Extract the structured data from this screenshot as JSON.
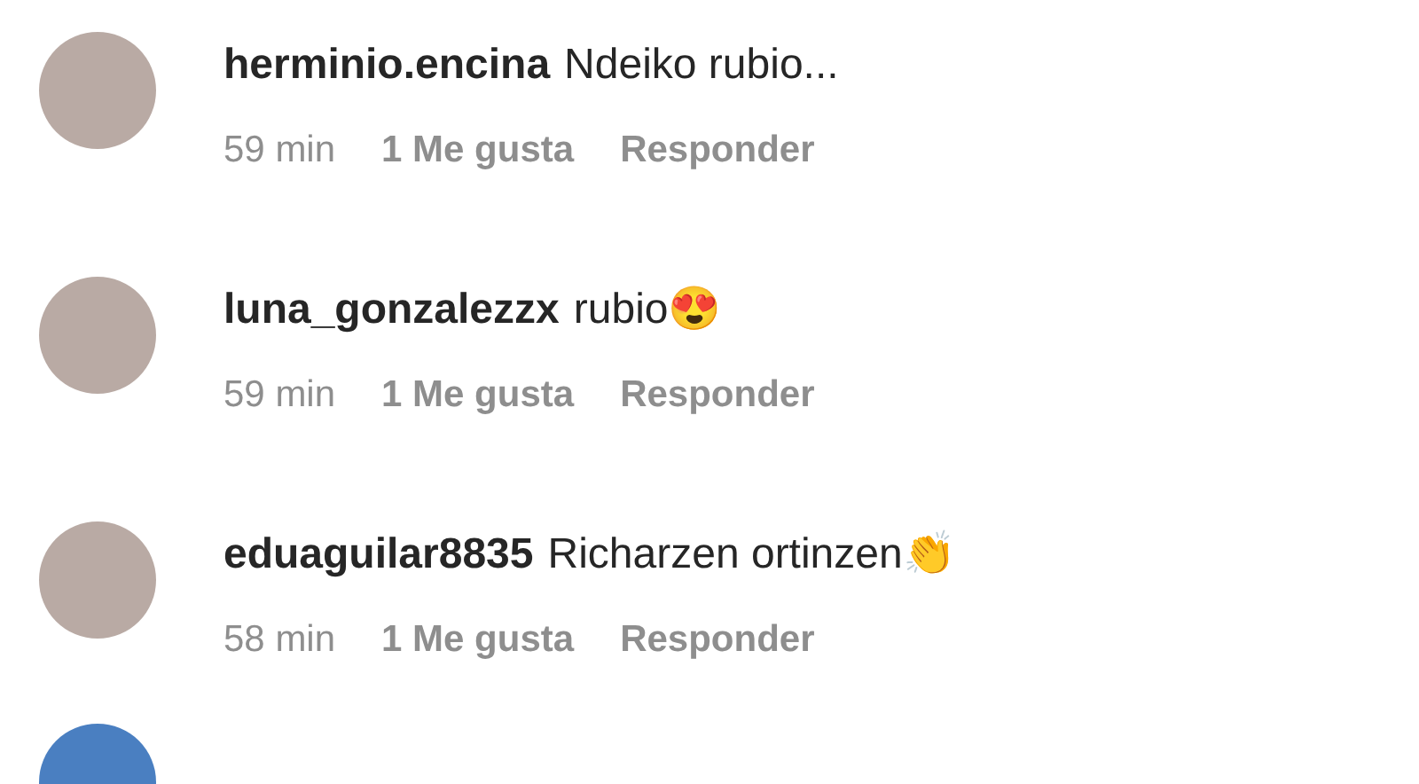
{
  "comments": [
    {
      "username": "herminio.encina",
      "text": "Ndeiko rubio...",
      "time": "59 min",
      "likes": "1 Me gusta",
      "reply": "Responder"
    },
    {
      "username": "luna_gonzalezzx",
      "text": "rubio😍",
      "time": "59 min",
      "likes": "1 Me gusta",
      "reply": "Responder"
    },
    {
      "username": "eduaguilar8835",
      "text": "Richarzen ortinzen👏",
      "time": "58 min",
      "likes": "1 Me gusta",
      "reply": "Responder"
    }
  ],
  "next_comment_cut_off": true
}
